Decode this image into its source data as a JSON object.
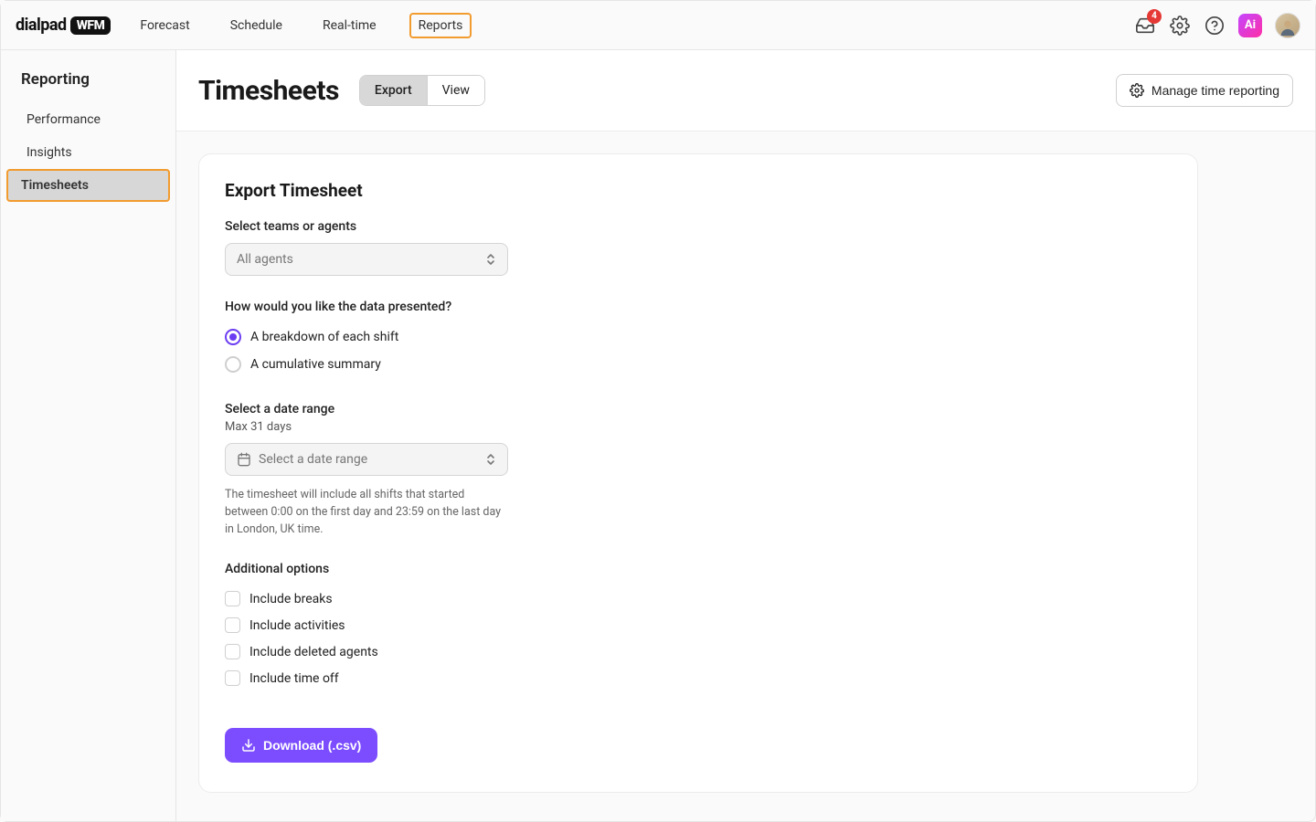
{
  "brand": {
    "name": "dialpad",
    "suffix": "WFM"
  },
  "nav": {
    "items": [
      "Forecast",
      "Schedule",
      "Real-time",
      "Reports"
    ],
    "active_index": 3,
    "notification_count": "4",
    "ai_label": "Ai"
  },
  "sidebar": {
    "title": "Reporting",
    "items": [
      "Performance",
      "Insights",
      "Timesheets"
    ],
    "active_index": 2
  },
  "header": {
    "title": "Timesheets",
    "tabs": [
      "Export",
      "View"
    ],
    "active_tab": 0,
    "manage_btn": "Manage time reporting"
  },
  "form": {
    "title": "Export Timesheet",
    "teams": {
      "label": "Select teams or agents",
      "value": "All agents"
    },
    "presentation": {
      "label": "How would you like the data presented?",
      "options": [
        "A breakdown of each shift",
        "A cumulative summary"
      ],
      "selected": 0
    },
    "daterange": {
      "label": "Select a date range",
      "sub": "Max 31 days",
      "placeholder": "Select a date range",
      "help": "The timesheet will include all shifts that started between 0:00 on the first day and 23:59 on the last day in London, UK time."
    },
    "options": {
      "label": "Additional options",
      "items": [
        "Include breaks",
        "Include activities",
        "Include deleted agents",
        "Include time off"
      ]
    },
    "download_btn": "Download (.csv)"
  }
}
